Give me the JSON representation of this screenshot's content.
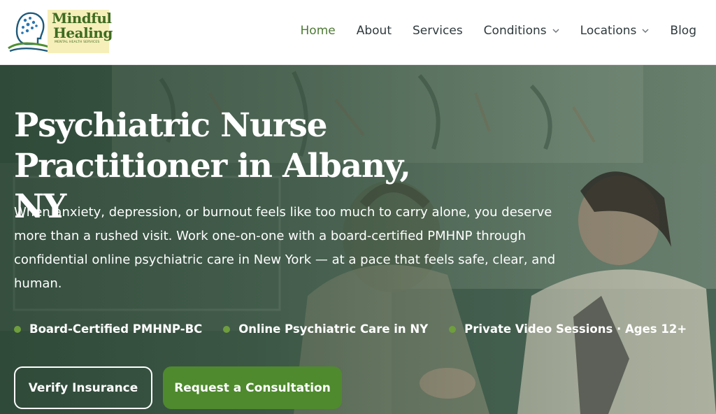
{
  "brand": {
    "name_line1": "Mindful",
    "name_line2": "Healing",
    "tagline": "MENTAL HEALTH SERVICES",
    "colors": {
      "brand_green": "#4e7a35",
      "logo_bg": "#f6efb9",
      "accent_dot": "#6f9e3d",
      "cta_green": "#4f8a2e"
    }
  },
  "nav": {
    "items": [
      {
        "label": "Home",
        "active": true
      },
      {
        "label": "About"
      },
      {
        "label": "Services"
      },
      {
        "label": "Conditions",
        "icon": "chevron-down-icon"
      },
      {
        "label": "Locations",
        "icon": "chevron-down-icon"
      },
      {
        "label": "Blog"
      }
    ]
  },
  "hero": {
    "title_line1": "Psychiatric Nurse",
    "title_line2": "Practitioner in Albany, NY",
    "description": "When anxiety, depression, or burnout feels like too much to carry alone, you deserve more than a rushed visit. Work one-on-one with a board-certified PMHNP through confidential online psychiatric care in New York — at a pace that feels safe, clear, and human.",
    "badges": [
      "Board-Certified PMHNP-BC",
      "Online Psychiatric Care in NY",
      "Private Video Sessions · Ages 12+"
    ],
    "buttons": {
      "verify": "Verify Insurance",
      "consult": "Request a Consultation"
    }
  }
}
